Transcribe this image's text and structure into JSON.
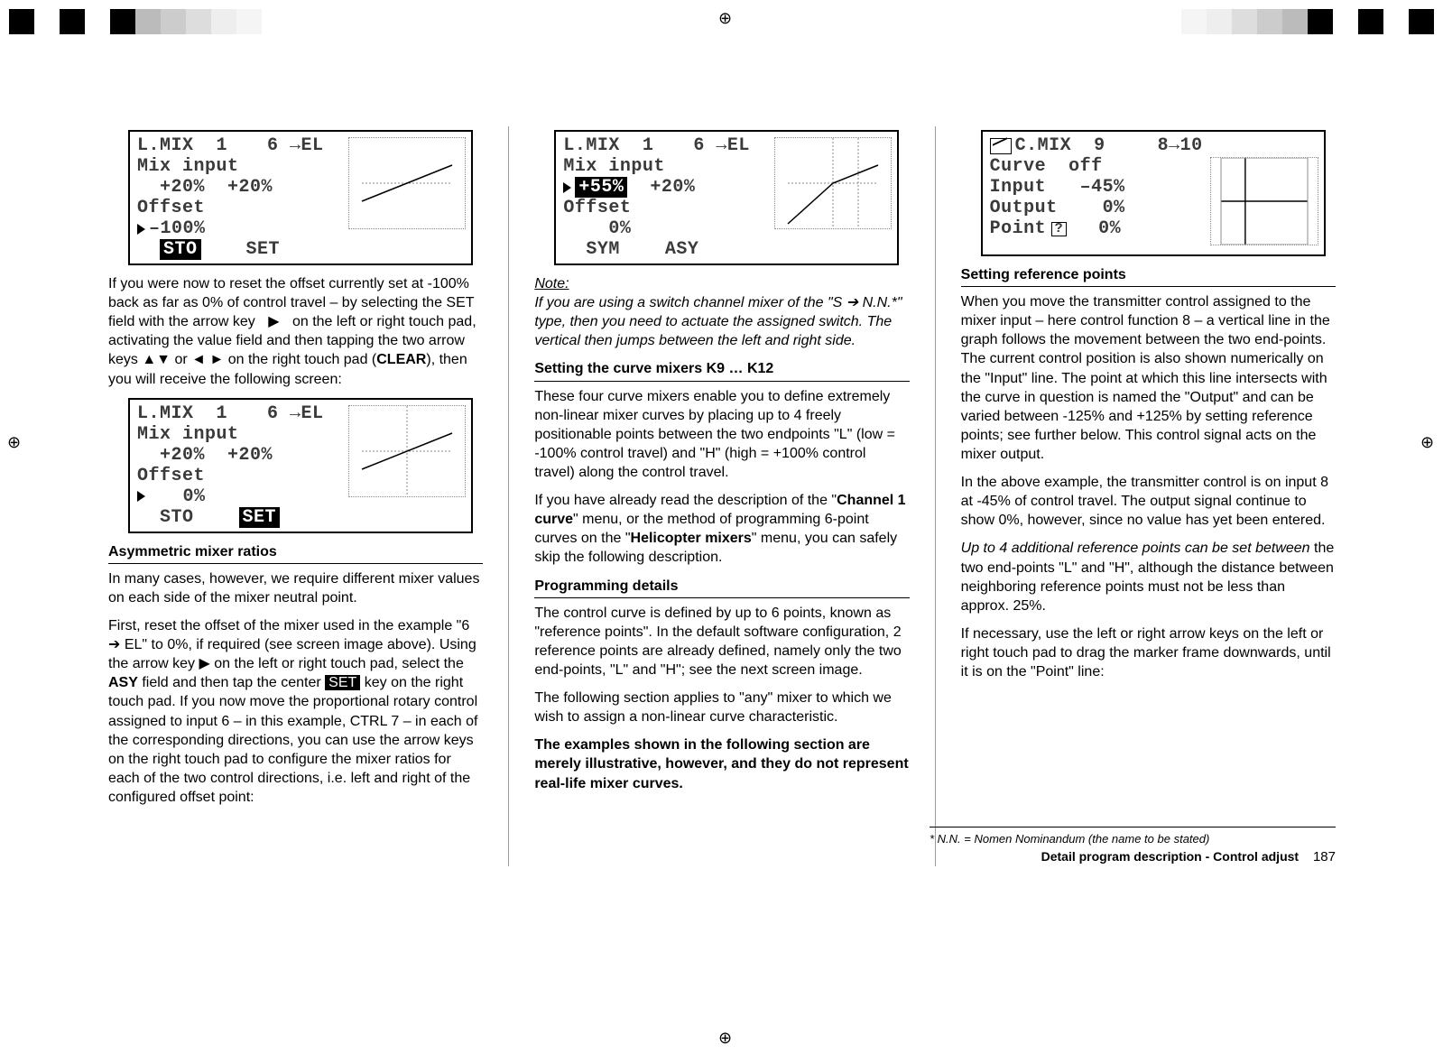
{
  "registration_glyph": "⊕",
  "lcd1": {
    "title_left": "L.MIX  1",
    "title_right": "6 →EL",
    "line2": "Mix input",
    "line3": "  +20%  +20%",
    "line4": "Offset",
    "line5_marker": "▶",
    "line5_val": "–100%",
    "btn1": "STO",
    "btn2": "SET"
  },
  "para1a": "If you were now to reset the offset currently set at -100% back as far as 0% of control travel – by selecting the SET field with the arrow key",
  "para1a_arrow": "▶",
  "para1b": "on the left or right touch pad, activating the value field and then tapping the two arrow keys ▲▼ or ◄ ► on the right touch pad (",
  "para1b_clear": "CLEAR",
  "para1c": "), then you will receive the following screen:",
  "lcd2": {
    "title_left": "L.MIX  1",
    "title_right": "6 →EL",
    "line2": "Mix input",
    "line3": "  +20%  +20%",
    "line4": "Offset",
    "line5_marker": "▶",
    "line5_val": "   0%",
    "btn1": "STO",
    "btn2": "SET"
  },
  "h_asym": "Asymmetric mixer ratios",
  "para2": "In many cases, however, we require different mixer values on each side of the mixer neutral point.",
  "para3a": "First, reset the offset of the mixer used in the example \"6 ➔ EL\" to 0%, if required (see screen image above). Using the arrow key ▶ on the left or right touch pad, select the ",
  "para3_asy": "ASY",
  "para3b": " field and then tap the center ",
  "para3_set": "SET",
  "para3c": " key on the right touch pad. If you now move the proportional rotary control assigned to input 6 – in this example, CTRL 7 – in each of the corresponding directions, you can use the  arrow keys on the right touch pad to configure the mixer ratios for each of the two control directions, i.e. left and right of the configured offset point:",
  "lcd3": {
    "title_left": "L.MIX  1",
    "title_right": "6 →EL",
    "line2": "Mix input",
    "line3_marker": "▶",
    "line3_val1": "+55%",
    "line3_val2": "+20%",
    "line4": "Offset",
    "line5": "    0%",
    "btn1": "SYM",
    "btn2": "ASY"
  },
  "note_label": "Note:",
  "note_text": "If you are using a switch channel mixer of the \"S ➔ N.N.*\" type, then you need to actuate the assigned switch. The vertical then jumps between the left and right side.",
  "h_setting_curve": "Setting the curve mixers K9 … K12",
  "para4": "These four curve mixers enable you to define extremely non-linear mixer curves by placing up to 4 freely positionable points between the two endpoints \"L\" (low = -100% control travel) and \"H\" (high = +100% control travel) along the control travel.",
  "para5a": "If you have already read the description of the \"",
  "para5_ch1": "Channel 1 curve",
  "para5b": "\" menu, or the method of programming 6-point curves on the \"",
  "para5_heli": "Helicopter mixers",
  "para5c": "\" menu, you can safely skip the following description.",
  "h_prog": "Programming details",
  "para6": "The control curve is defined by up to 6 points, known as \"reference points\". In the default software configuration, 2 reference points are already defined, namely only the two end-points, \"L\" and \"H\"; see the next screen image.",
  "para7": "The following section applies to \"any\" mixer to which we wish to assign a non-linear curve characteristic.",
  "para8": "The examples shown in the following section are merely illustrative, however, and they do not represent real-life mixer curves.",
  "lcd4": {
    "title_left": "C.MIX  9",
    "title_right": "8→10",
    "line2": "Curve  off",
    "r1_lbl": "Input",
    "r1_val": "–45%",
    "r2_lbl": "Output",
    "r2_val": "0%",
    "r3_lbl": "Point",
    "r3_q": "?",
    "r3_val": "0%"
  },
  "h_ref": "Setting reference points",
  "para9": "When you move the transmitter control assigned to the mixer input – here control function 8 – a vertical line in the graph follows the movement between the two end-points. The current control position is also shown numerically on the \"Input\" line. The point at which this line intersects with the curve in question is named the \"Output\" and can be varied between -125% and +125% by setting reference points; see further below. This control signal acts on the mixer output.",
  "para10": "In the above example, the transmitter control is on input 8 at -45% of control travel. The output signal continue to show 0%, however, since no value has yet been entered.",
  "para11a": "Up to 4 additional reference points can be set between",
  "para11b": " the two end-points \"L\" and \"H\", although the distance between neighboring reference points must not be less than approx. 25%.",
  "para12": "If necessary, use the left or right arrow keys on the left or right touch pad to drag the marker frame downwards, until it is on the \"Point\" line:",
  "footnote": "*    N.N. = Nomen Nominandum (the name to be stated)",
  "footer_title": "Detail program description - Control adjust",
  "page_num": "187"
}
